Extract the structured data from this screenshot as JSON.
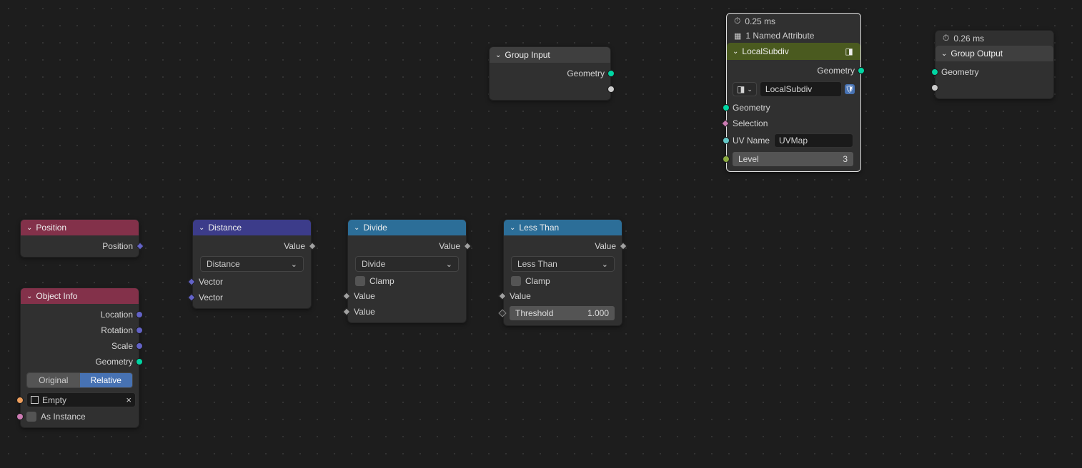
{
  "nodes": {
    "position": {
      "title": "Position",
      "out_position": "Position"
    },
    "object_info": {
      "title": "Object Info",
      "out_location": "Location",
      "out_rotation": "Rotation",
      "out_scale": "Scale",
      "out_geometry": "Geometry",
      "toggle_original": "Original",
      "toggle_relative": "Relative",
      "object_field": "Empty",
      "as_instance": "As Instance"
    },
    "distance": {
      "title": "Distance",
      "out_value": "Value",
      "mode": "Distance",
      "in_vector_a": "Vector",
      "in_vector_b": "Vector"
    },
    "divide": {
      "title": "Divide",
      "out_value": "Value",
      "mode": "Divide",
      "clamp": "Clamp",
      "in_value_a": "Value",
      "in_value_b": "Value"
    },
    "less_than": {
      "title": "Less Than",
      "out_value": "Value",
      "mode": "Less Than",
      "clamp": "Clamp",
      "in_value": "Value",
      "threshold_label": "Threshold",
      "threshold_value": "1.000"
    },
    "group_input": {
      "title": "Group Input",
      "out_geometry": "Geometry"
    },
    "local_subdiv": {
      "time": "0.25 ms",
      "attributes": "1 Named Attribute",
      "title": "LocalSubdiv",
      "group_name": "LocalSubdiv",
      "out_geometry": "Geometry",
      "in_geometry": "Geometry",
      "in_selection": "Selection",
      "uv_label": "UV Name",
      "uv_value": "UVMap",
      "level_label": "Level",
      "level_value": "3"
    },
    "group_output": {
      "time": "0.26 ms",
      "title": "Group Output",
      "in_geometry": "Geometry"
    }
  }
}
